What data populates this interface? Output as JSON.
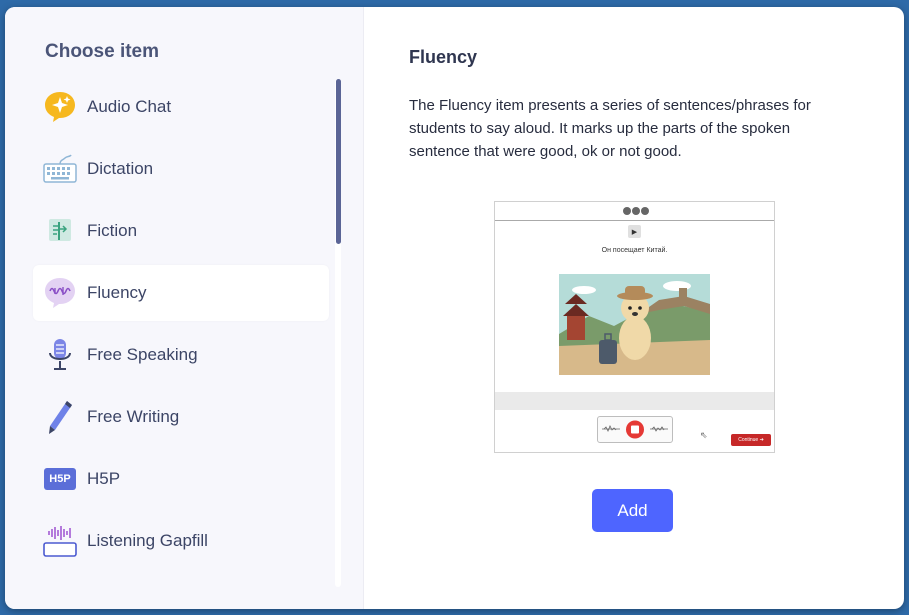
{
  "sidebar": {
    "title": "Choose item",
    "items": [
      {
        "label": "Audio Chat",
        "icon": "sparkle-chat-icon"
      },
      {
        "label": "Dictation",
        "icon": "keyboard-icon"
      },
      {
        "label": "Fiction",
        "icon": "book-page-icon"
      },
      {
        "label": "Fluency",
        "icon": "speech-wave-icon",
        "selected": true
      },
      {
        "label": "Free Speaking",
        "icon": "microphone-icon"
      },
      {
        "label": "Free Writing",
        "icon": "pen-icon"
      },
      {
        "label": "H5P",
        "icon": "h5p-icon",
        "badge": "H5P"
      },
      {
        "label": "Listening Gapfill",
        "icon": "audio-wave-box-icon"
      }
    ]
  },
  "detail": {
    "title": "Fluency",
    "description": "The Fluency item presents a series of sentences/phrases for students to say aloud. It marks up the parts of the spoken sentence that were good, ok or not good.",
    "preview": {
      "sentence": "Он посещает Китай.",
      "continue_label": "Continue ➔"
    },
    "add_label": "Add"
  },
  "colors": {
    "accent": "#4e65ff",
    "sidebar_bg": "#f7f7fc",
    "scroll_thumb": "#5b6596",
    "continue": "#c62828"
  }
}
